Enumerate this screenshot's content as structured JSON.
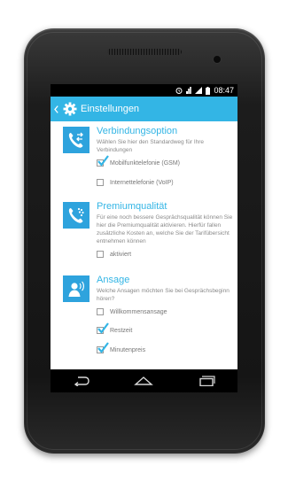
{
  "status_bar": {
    "time": "08:47"
  },
  "action_bar": {
    "title": "Einstellungen"
  },
  "sections": [
    {
      "title": "Verbindungsoption",
      "description": "Wählen Sie hier den Standardweg für Ihre Verbindungen",
      "options": [
        {
          "label": "Mobilfunktelefonie (GSM)",
          "checked": true
        },
        {
          "label": "Internettelefonie (VoIP)",
          "checked": false
        }
      ]
    },
    {
      "title": "Premiumqualität",
      "description": "Für eine noch bessere Gesprächsqualität können Sie hier die Premiumqualität aktivieren. Hierfür fallen zusätzliche Kosten an, welche Sie der Tarifübersicht entnehmen können",
      "options": [
        {
          "label": "aktiviert",
          "checked": false
        }
      ]
    },
    {
      "title": "Ansage",
      "description": "Welche Ansagen möchten Sie bei Gesprächsbeginn hören?",
      "options": [
        {
          "label": "Willkommensansage",
          "checked": false
        },
        {
          "label": "Restzeit",
          "checked": true
        },
        {
          "label": "Minutenpreis",
          "checked": true
        }
      ]
    }
  ],
  "icons": {
    "status": [
      "alarm-icon",
      "wifi-icon",
      "signal-icon",
      "battery-icon"
    ],
    "navigation": [
      "back-nav-icon",
      "home-nav-icon",
      "recent-apps-icon"
    ]
  },
  "colors": {
    "accent": "#33b5e5",
    "section_icon_bg": "#2ea3dd",
    "phone_body": "#1c1c1c"
  }
}
